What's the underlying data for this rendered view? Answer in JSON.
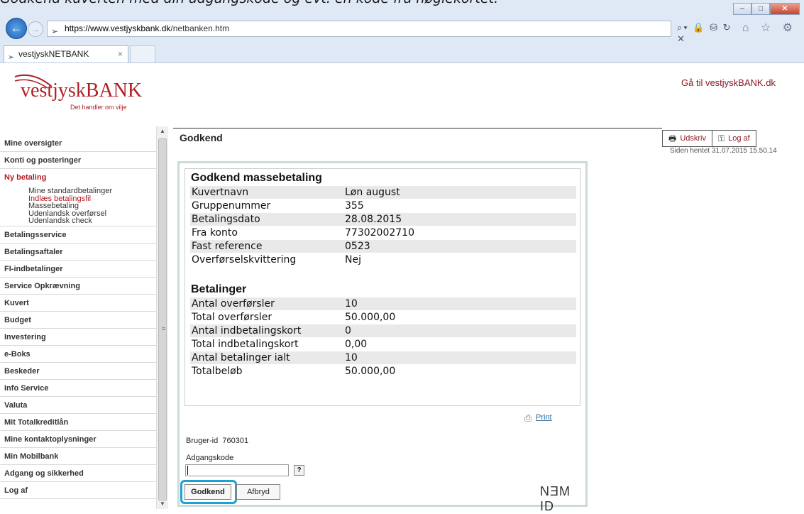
{
  "caption": "Godkend kuverten med din adgangskode og evt. en kode fra nøglekortet.",
  "browser": {
    "url_host": "https://www.vestjyskbank.dk",
    "url_path": "/netbanken.htm",
    "tab_title": "vestjyskNETBANK",
    "tab_close": "×",
    "addr_tools": "⌕▾ 🔒 ⛁ ↻ ✕",
    "nav_icons": "⌂ ☆ ⚙",
    "back": "←",
    "forward": "→",
    "win_min": "–",
    "win_max": "□",
    "win_close": "✕"
  },
  "header": {
    "logo_word": "vestjyskBANK",
    "logo_tagline": "Det handler om vilje",
    "goto_link": "Gå til vestjyskBANK.dk"
  },
  "sidebar": {
    "items": [
      {
        "label": "Mine oversigter"
      },
      {
        "label": "Konti og posteringer"
      },
      {
        "label": "Ny betaling",
        "active": true
      },
      {
        "label": "Betalingsservice"
      },
      {
        "label": "Betalingsaftaler"
      },
      {
        "label": "FI-indbetalinger"
      },
      {
        "label": "Service Opkrævning"
      },
      {
        "label": "Kuvert"
      },
      {
        "label": "Budget"
      },
      {
        "label": "Investering"
      },
      {
        "label": "e-Boks"
      },
      {
        "label": "Beskeder"
      },
      {
        "label": "Info Service"
      },
      {
        "label": "Valuta"
      },
      {
        "label": "Mit Totalkreditlån"
      },
      {
        "label": "Mine kontaktoplysninger"
      },
      {
        "label": "Min Mobilbank"
      },
      {
        "label": "Adgang og sikkerhed"
      },
      {
        "label": "Log af"
      }
    ],
    "sub_items": [
      {
        "label": "Mine standardbetalinger"
      },
      {
        "label": "Indlæs betalingsfil",
        "active": true
      },
      {
        "label": "Massebetaling"
      },
      {
        "label": "Udenlandsk overførsel"
      },
      {
        "label": "Udenlandsk check"
      }
    ]
  },
  "content": {
    "title": "Godkend",
    "print_button": "Udskriv",
    "logout_button": "Log af",
    "fetched": "Siden hentet 31.07.2015 15.50.14"
  },
  "approval": {
    "heading": "Godkend massebetaling",
    "rows": [
      {
        "k": "Kuvertnavn",
        "v": "Løn august"
      },
      {
        "k": "Gruppenummer",
        "v": "355"
      },
      {
        "k": "Betalingsdato",
        "v": "28.08.2015"
      },
      {
        "k": "Fra konto",
        "v": "77302002710"
      },
      {
        "k": "Fast reference",
        "v": "0523"
      },
      {
        "k": "Overførselskvittering",
        "v": "Nej"
      }
    ],
    "payments_heading": "Betalinger",
    "payments": [
      {
        "k": "Antal overførsler",
        "v": "10"
      },
      {
        "k": "Total overførsler",
        "v": "50.000,00"
      },
      {
        "k": "Antal indbetalingskort",
        "v": "0"
      },
      {
        "k": "Total indbetalingskort",
        "v": "0,00"
      },
      {
        "k": "Antal betalinger ialt",
        "v": "10"
      },
      {
        "k": "Totalbeløb",
        "v": "50.000,00"
      }
    ]
  },
  "nemid": {
    "print_link": "Print",
    "user_id_label": "Bruger-id",
    "user_id": "760301",
    "password_label": "Adgangskode",
    "password_value": "",
    "help": "?",
    "approve": "Godkend",
    "cancel": "Afbryd",
    "brand": "NƎM ID"
  }
}
